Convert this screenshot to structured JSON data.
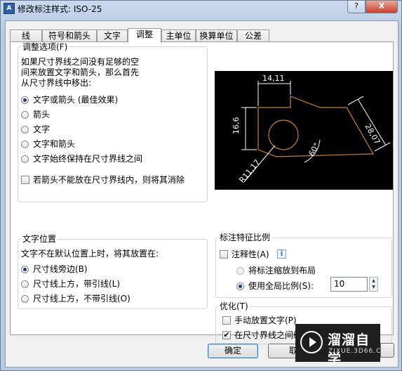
{
  "window": {
    "title": "修改标注样式: ISO-25",
    "help_label": "?",
    "close_label": "X",
    "icon_label": "A"
  },
  "tabs": [
    {
      "label": "线"
    },
    {
      "label": "符号和箭头"
    },
    {
      "label": "文字"
    },
    {
      "label": "调整",
      "active": true
    },
    {
      "label": "主单位"
    },
    {
      "label": "换算单位"
    },
    {
      "label": "公差"
    }
  ],
  "fit_options": {
    "title": "调整选项(F)",
    "description": [
      "如果尺寸界线之间没有足够的空",
      "间来放置文字和箭头，那么首先",
      "从尺寸界线中移出:"
    ],
    "radios": [
      {
        "label": "文字或箭头 (最佳效果)",
        "selected": true
      },
      {
        "label": "箭头",
        "selected": false
      },
      {
        "label": "文字",
        "selected": false
      },
      {
        "label": "文字和箭头",
        "selected": false
      },
      {
        "label": "文字始终保持在尺寸界线之间",
        "selected": false
      }
    ],
    "suppress_checkbox": {
      "label": "若箭头不能放在尺寸界线内，则将其消除",
      "checked": false
    }
  },
  "preview": {
    "dim_top": "14,11",
    "dim_left": "16,6",
    "dim_right": "28,07",
    "angle": "60°",
    "radius": "R11,17"
  },
  "text_placement": {
    "title": "文字位置",
    "description": "文字不在默认位置上时，将其放置在:",
    "radios": [
      {
        "label": "尺寸线旁边(B)",
        "selected": true
      },
      {
        "label": "尺寸线上方，带引线(L)",
        "selected": false
      },
      {
        "label": "尺寸线上方，不带引线(O)",
        "selected": false
      }
    ]
  },
  "scale": {
    "title": "标注特征比例",
    "annotative": {
      "label": "注释性(A)",
      "checked": false
    },
    "info_icon": "i",
    "radios": [
      {
        "label": "将标注缩放到布局",
        "selected": false
      },
      {
        "label": "使用全局比例(S):",
        "selected": true
      }
    ],
    "scale_value": "10"
  },
  "fine_tuning": {
    "title": "优化(T)",
    "checks": [
      {
        "label": "手动放置文字(P)",
        "checked": false
      },
      {
        "label": "在尺寸界线之间绘制尺寸线(D)",
        "checked": true
      }
    ]
  },
  "buttons": {
    "ok": "确定",
    "cancel": "取"
  },
  "watermark": {
    "main": "溜溜自学",
    "sub": "ZIXUE.3D66.COM"
  }
}
